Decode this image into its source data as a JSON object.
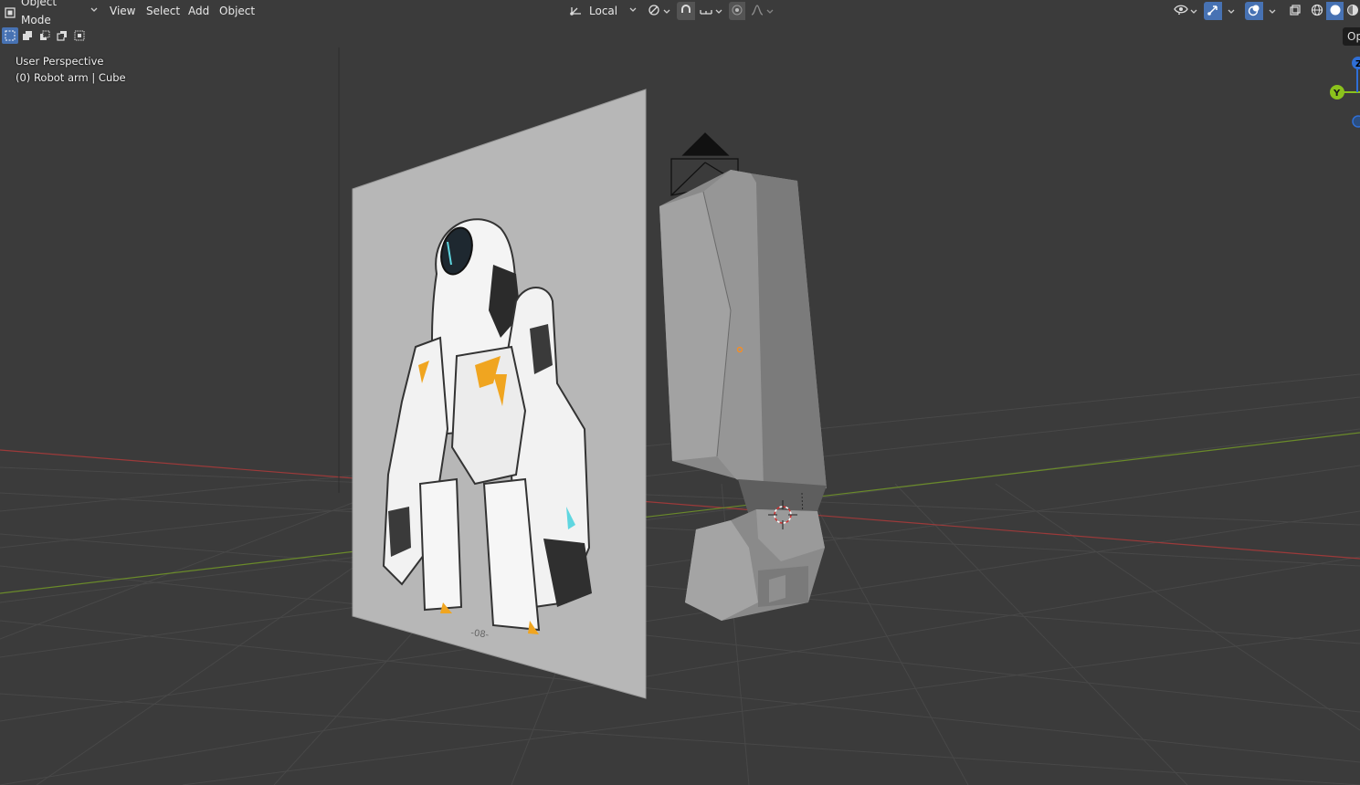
{
  "header": {
    "mode_label": "Object Mode",
    "menus": [
      "View",
      "Select",
      "Add",
      "Object"
    ],
    "transform_orientation": "Local"
  },
  "icons": {
    "mode": "object-mode-icon",
    "orientation": "transform-orientation-icon",
    "pivot": "pivot-point-icon",
    "snap": "snap-magnet-icon",
    "snap_target": "snap-increment-icon",
    "proportional": "proportional-edit-icon",
    "falloff": "falloff-curve-icon",
    "visibility": "eye-visibility-icon",
    "gizmo": "gizmo-icon",
    "overlays": "overlays-icon",
    "xray": "xray-icon",
    "shading_wire": "wireframe-shading-icon",
    "shading_solid": "solid-shading-icon",
    "shading_material": "material-shading-icon"
  },
  "viewport": {
    "view_name": "User Perspective",
    "active_object": "(0) Robot arm | Cube",
    "reference_caption": "-08-"
  },
  "navigation_gizmo": {
    "y_label": "Y",
    "z_label": "Z"
  },
  "sidebar_tab": {
    "label": "Op"
  },
  "colors": {
    "background": "#3b3b3b",
    "accent": "#4772b3",
    "axis_x": "#9c3a3a",
    "axis_y": "#6a8a2a",
    "gizmo_y": "#8bc21c",
    "gizmo_z": "#2f6fd6"
  }
}
